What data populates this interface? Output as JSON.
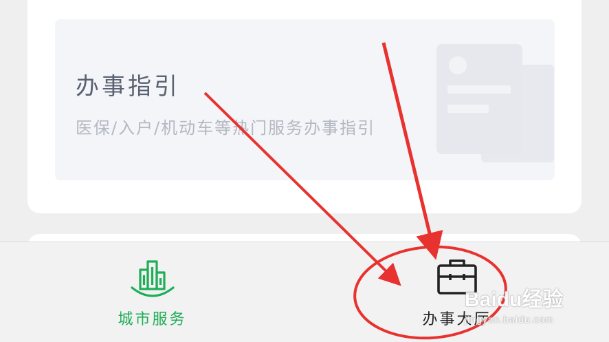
{
  "guide_card": {
    "title": "办事指引",
    "subtitle": "医保/入户/机动车等热门服务办事指引"
  },
  "tabbar": {
    "tabs": [
      {
        "label": "城市服务",
        "icon": "city-buildings-icon",
        "color": "#1fae58",
        "active": true
      },
      {
        "label": "办事大厅",
        "icon": "briefcase-icon",
        "color": "#222222",
        "active": false
      }
    ]
  },
  "annotation": {
    "color": "#e8322f"
  },
  "watermark": {
    "logo": "Baidu经验",
    "url": "jingyan.baidu.com"
  }
}
